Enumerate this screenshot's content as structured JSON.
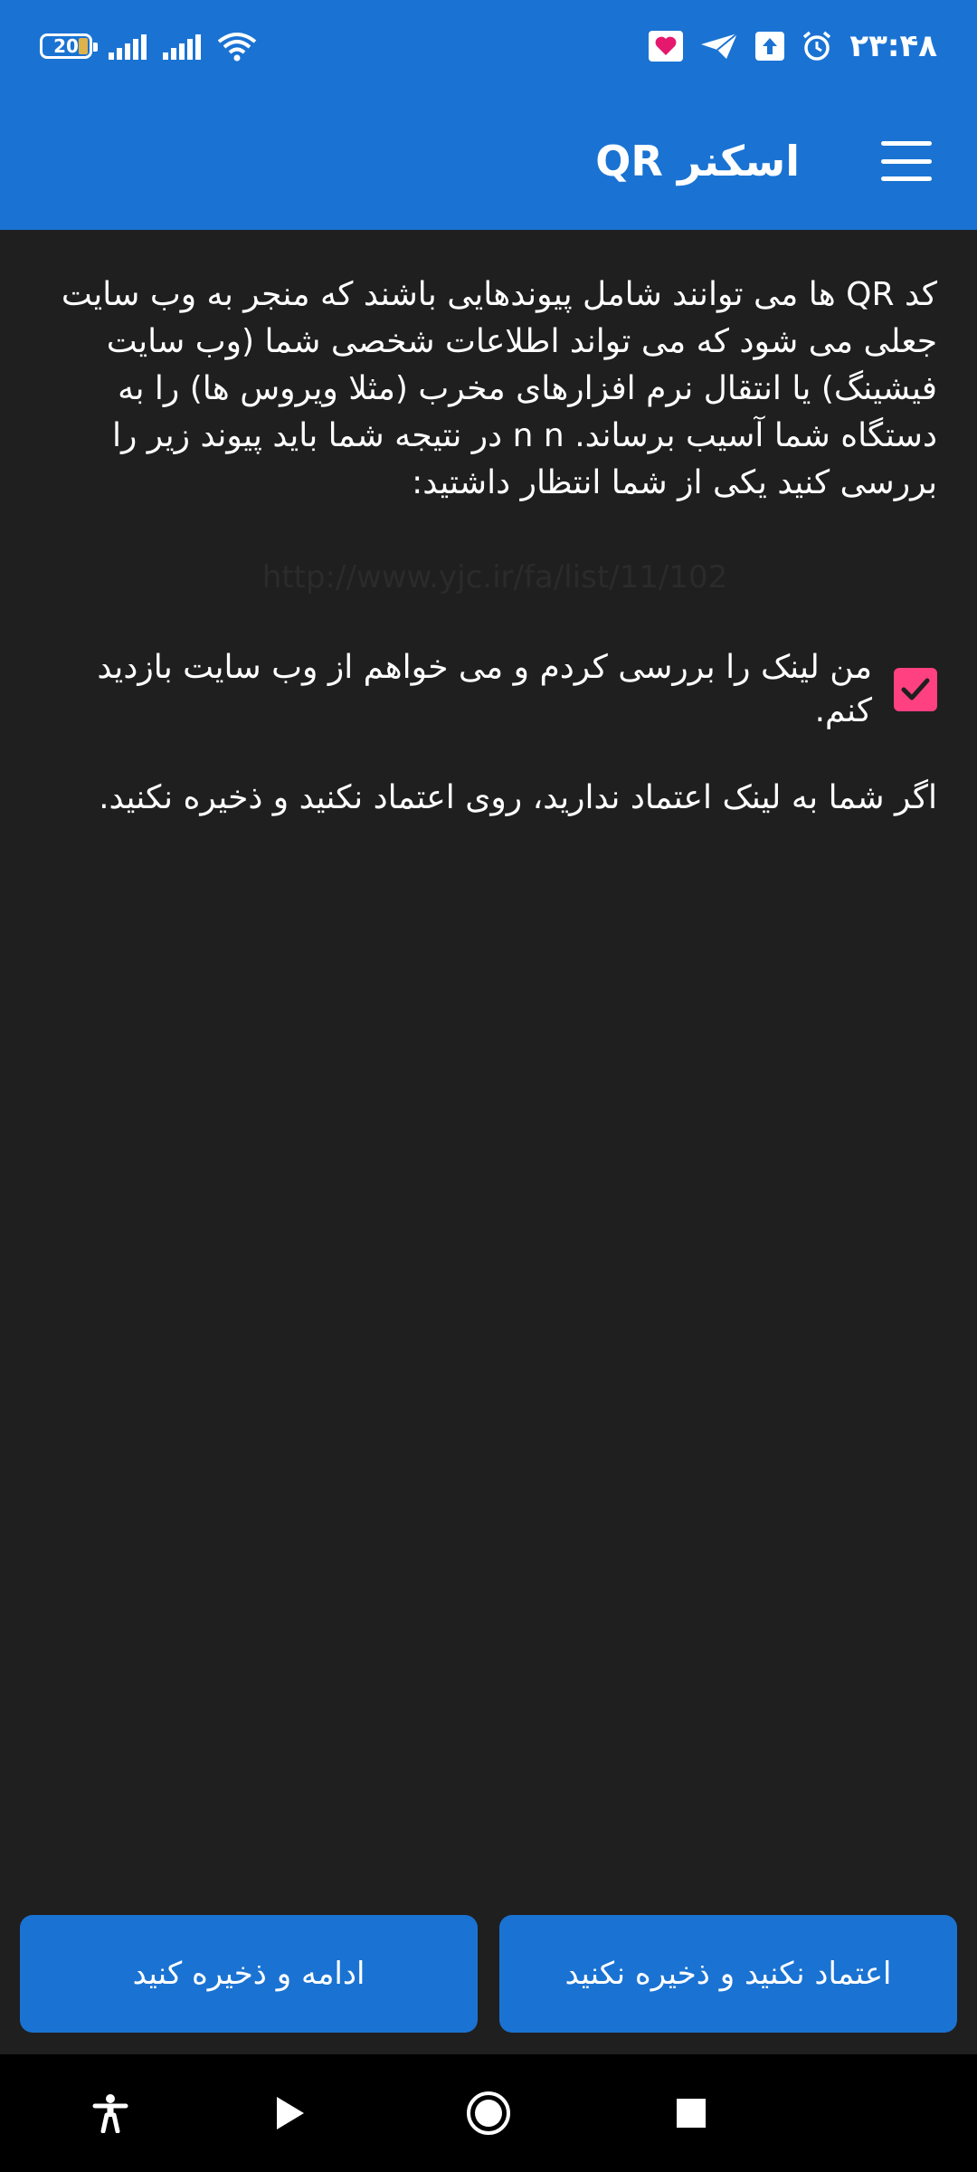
{
  "status_bar": {
    "battery": "20",
    "time": "۲۳:۴۸"
  },
  "app_bar": {
    "title": "اسکنر QR"
  },
  "content": {
    "warning_text": "کد QR ها می توانند شامل پیوندهایی باشند که منجر به وب سایت جعلی می شود که می تواند اطلاعات شخصی شما (وب سایت فیشینگ) یا انتقال نرم افزارهای مخرب (مثلا ویروس ها) را به دستگاه شما آسیب برساند. n n در نتیجه شما باید پیوند زیر را بررسی کنید یکی از شما انتظار داشتید:",
    "link": "http://www.yjc.ir/fa/list/11/102",
    "checkbox_label": "من لینک را بررسی کردم و می خواهم از وب سایت بازدید کنم.",
    "checkbox_checked": true,
    "note": "اگر شما به لینک اعتماد ندارید، روی اعتماد نکنید و ذخیره نکنید."
  },
  "buttons": {
    "distrust_label": "اعتماد نکنید و ذخیره نکنید",
    "continue_label": "ادامه و ذخیره کنید"
  },
  "colors": {
    "primary": "#1a73d3",
    "accent": "#ff4081",
    "background": "#1f1f1f"
  }
}
